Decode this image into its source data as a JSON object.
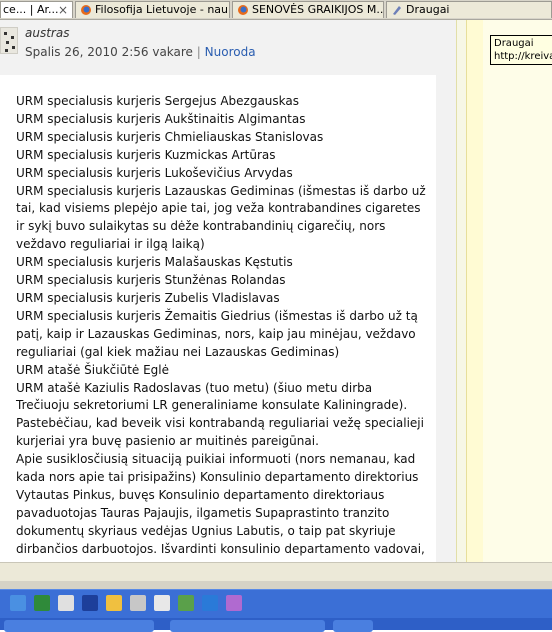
{
  "tabs": [
    {
      "label": "ce... | Ar...",
      "active": true,
      "close": "×"
    },
    {
      "label": "Filosofija Lietuvoje - nau...",
      "active": false
    },
    {
      "label": "SENOVĖS GRAIKIJOS M...",
      "active": false
    },
    {
      "label": "Draugai",
      "active": false
    }
  ],
  "tooltip": {
    "title": "Draugai",
    "url": "http://kreiva"
  },
  "comment": {
    "author": "austras",
    "date": "Spalis 26, 2010 2:56 vakare",
    "separator": "|",
    "link_label": "Nuoroda",
    "lines": [
      "URM specialusis kurjeris Sergejus Abezgauskas",
      "URM specialusis kurjeris Aukštinaitis Algimantas",
      "URM specialusis kurjeris Chmieliauskas Stanislovas",
      "URM specialusis kurjeris Kuzmickas Artūras",
      "URM specialusis kurjeris Lukoševičius Arvydas",
      "URM specialusis kurjeris Lazauskas Gediminas (išmestas iš darbo už",
      "tai, kad visiems plepėjo apie tai, jog veža kontrabandines cigaretes",
      "ir sykį buvo sulaikytas su dėže kontrabandinių cigarečių, nors",
      "veždavo reguliariai ir ilgą laiką)",
      "URM specialusis kurjeris Malašauskas Kęstutis",
      "URM specialusis kurjeris Stunžėnas Rolandas",
      "URM specialusis kurjeris Zubelis Vladislavas",
      "URM specialusis kurjeris Žemaitis Giedrius (išmestas iš darbo už tą",
      "patį, kaip ir Lazauskas Gediminas, nors, kaip jau minėjau, veždavo",
      "reguliariai (gal kiek mažiau nei Lazauskas Gediminas)",
      "URM atašė Šiukčiūtė Eglė",
      "URM atašė Kaziulis Radoslavas (tuo metu) (šiuo metu dirba",
      "Trečiuoju sekretoriumi LR generaliniame konsulate Kaliningrade).",
      "Pastebėčiau, kad beveik visi kontrabandą reguliariai vežę specialieji",
      "kurjeriai yra buvę pasienio ar muitinės pareigūnai.",
      "Apie susiklosčiusią situaciją puikiai informuoti (nors nemanau, kad",
      "kada nors apie tai prisipažins) Konsulinio departamento direktorius",
      "Vytautas Pinkus, buvęs Konsulinio departamento direktoriaus",
      "pavaduotojas Tauras Pajaujis, ilgametis Supaprastinto tranzito",
      "dokumentų skyriaus vedėjas Ugnius Labutis, o taip pat skyriuje",
      "dirbančios darbuotojos. Išvardinti konsulinio departamento vadovai,"
    ]
  },
  "colors": {
    "tabbar": "#d7d4c9",
    "link": "#2a5db0",
    "taskbar": "#3b6fd6"
  },
  "quicklaunch_icons": [
    "web-icon",
    "ovl-icon",
    "media-icon",
    "word-icon",
    "folder-icon",
    "frame-icon",
    "calendar-icon",
    "camera-icon",
    "ie-icon",
    "paint-icon"
  ]
}
